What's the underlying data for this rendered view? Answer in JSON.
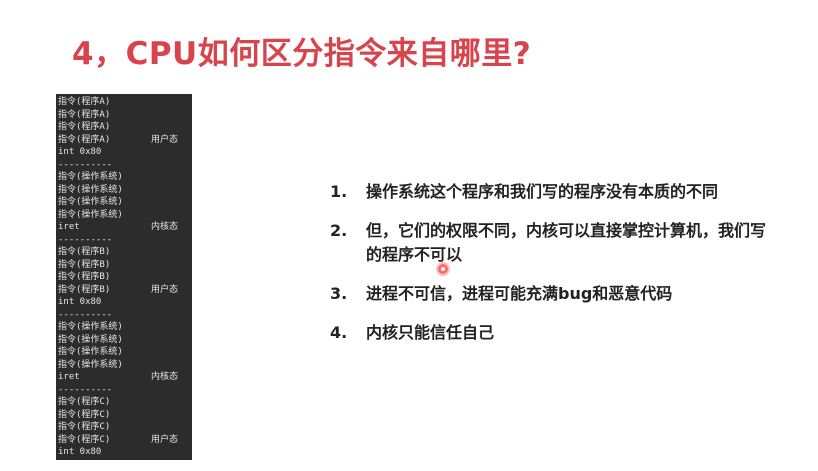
{
  "title": "4，CPU如何区分指令来自哪里?",
  "terminal": {
    "lines": [
      {
        "text": "指令(程序A)",
        "mode": ""
      },
      {
        "text": "指令(程序A)",
        "mode": ""
      },
      {
        "text": "指令(程序A)",
        "mode": ""
      },
      {
        "text": "指令(程序A)",
        "mode": "用户态"
      },
      {
        "text": "int 0x80",
        "mode": ""
      },
      {
        "text": "----------",
        "mode": ""
      },
      {
        "text": "指令(操作系统)",
        "mode": ""
      },
      {
        "text": "指令(操作系统)",
        "mode": ""
      },
      {
        "text": "指令(操作系统)",
        "mode": ""
      },
      {
        "text": "指令(操作系统)",
        "mode": ""
      },
      {
        "text": "iret",
        "mode": "内核态"
      },
      {
        "text": "----------",
        "mode": ""
      },
      {
        "text": "指令(程序B)",
        "mode": ""
      },
      {
        "text": "指令(程序B)",
        "mode": ""
      },
      {
        "text": "指令(程序B)",
        "mode": ""
      },
      {
        "text": "指令(程序B)",
        "mode": "用户态"
      },
      {
        "text": "int 0x80",
        "mode": ""
      },
      {
        "text": "----------",
        "mode": ""
      },
      {
        "text": "指令(操作系统)",
        "mode": ""
      },
      {
        "text": "指令(操作系统)",
        "mode": ""
      },
      {
        "text": "指令(操作系统)",
        "mode": ""
      },
      {
        "text": "指令(操作系统)",
        "mode": ""
      },
      {
        "text": "iret",
        "mode": "内核态"
      },
      {
        "text": "----------",
        "mode": ""
      },
      {
        "text": "指令(程序C)",
        "mode": ""
      },
      {
        "text": "指令(程序C)",
        "mode": ""
      },
      {
        "text": "指令(程序C)",
        "mode": ""
      },
      {
        "text": "指令(程序C)",
        "mode": "用户态"
      },
      {
        "text": "int 0x80",
        "mode": ""
      }
    ]
  },
  "points": [
    {
      "num": "1.",
      "text": "操作系统这个程序和我们写的程序没有本质的不同"
    },
    {
      "num": "2.",
      "text": "但，它们的权限不同，内核可以直接掌控计算机，我们写的程序不可以"
    },
    {
      "num": "3.",
      "text": "进程不可信，进程可能充满bug和恶意代码"
    },
    {
      "num": "4.",
      "text": "内核只能信任自己"
    }
  ],
  "colors": {
    "title": "#d9434b",
    "terminal_bg": "#2c2c2c",
    "pointer": "#ff6a6a"
  }
}
